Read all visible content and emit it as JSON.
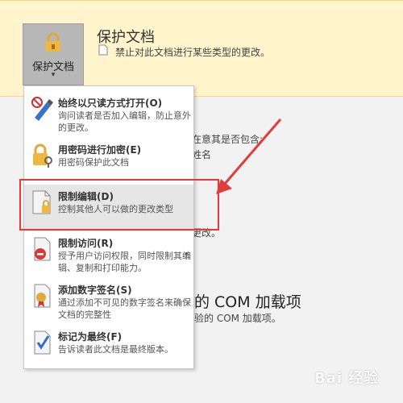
{
  "banner": {
    "button_label": "保护文档",
    "button_caret": "▾",
    "title": "保护文档",
    "description": "禁止对此文档进行某些类型的更改。"
  },
  "background": {
    "line1": "在意其是否包含:",
    "line2": "姓名",
    "line3": "更改。",
    "heading": "的 COM 加载项",
    "line4": "验的 COM 加载项。"
  },
  "menu": {
    "items": [
      {
        "title": "始终以只读方式打开(O)",
        "desc": "询问读者是否加入编辑，防止意外的更改。",
        "icon": "pencil-icon"
      },
      {
        "title": "用密码进行加密(E)",
        "desc": "用密码保护此文档",
        "icon": "lock-key-icon"
      },
      {
        "title": "限制编辑(D)",
        "desc": "控制其他人可以做的更改类型",
        "icon": "restrict-doc-icon"
      },
      {
        "title": "限制访问(R)",
        "desc": "授予用户访问权限，同时限制其编辑、复制和打印能力。",
        "icon": "restrict-access-icon",
        "submenu": "▸"
      },
      {
        "title": "添加数字签名(S)",
        "desc": "通过添加不可见的数字签名来确保文档的完整性",
        "icon": "signature-icon"
      },
      {
        "title": "标记为最终(F)",
        "desc": "告诉读者此文档是最终版本。",
        "icon": "final-check-icon"
      }
    ]
  },
  "watermark": "Bai 经验",
  "colors": {
    "banner_bg": "#fff4cc",
    "highlight": "#e23b3b",
    "button_bg": "#b7b7b7"
  }
}
